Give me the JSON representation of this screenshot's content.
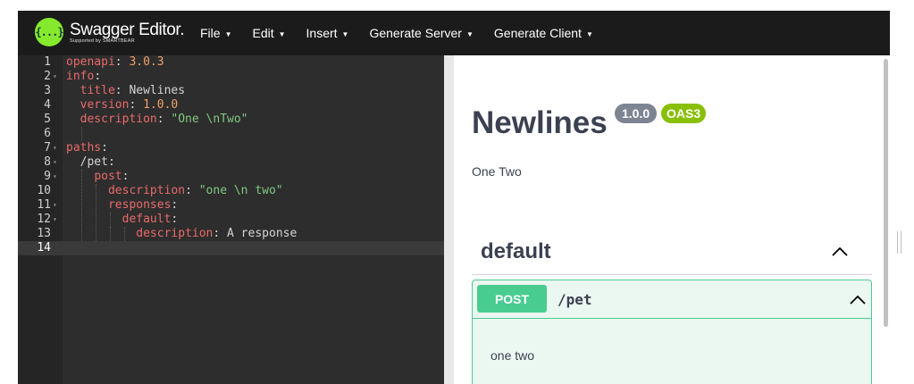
{
  "brand": {
    "title": "Swagger Editor.",
    "subtitle": "Supported by SMARTBEAR",
    "logo_glyph": "{...}"
  },
  "menu": [
    {
      "label": "File"
    },
    {
      "label": "Edit"
    },
    {
      "label": "Insert"
    },
    {
      "label": "Generate Server"
    },
    {
      "label": "Generate Client"
    }
  ],
  "editor": {
    "active_line": 14,
    "line_numbers": [
      "1",
      "2",
      "3",
      "4",
      "5",
      "6",
      "7",
      "8",
      "9",
      "10",
      "11",
      "12",
      "13",
      "14"
    ],
    "foldable_lines": [
      2,
      7,
      8,
      9,
      11,
      12
    ],
    "lines": [
      [
        {
          "c": "k",
          "t": "openapi"
        },
        {
          "c": "p",
          "t": ": "
        },
        {
          "c": "n",
          "t": "3.0.3"
        }
      ],
      [
        {
          "c": "k",
          "t": "info"
        },
        {
          "c": "p",
          "t": ":"
        }
      ],
      [
        {
          "c": "p",
          "t": "  "
        },
        {
          "c": "k",
          "t": "title"
        },
        {
          "c": "p",
          "t": ": "
        },
        {
          "c": "t",
          "t": "Newlines"
        }
      ],
      [
        {
          "c": "p",
          "t": "  "
        },
        {
          "c": "k",
          "t": "version"
        },
        {
          "c": "p",
          "t": ": "
        },
        {
          "c": "n",
          "t": "1.0.0"
        }
      ],
      [
        {
          "c": "p",
          "t": "  "
        },
        {
          "c": "k",
          "t": "description"
        },
        {
          "c": "p",
          "t": ": "
        },
        {
          "c": "s",
          "t": "\"One \\nTwo\""
        }
      ],
      [],
      [
        {
          "c": "k",
          "t": "paths"
        },
        {
          "c": "p",
          "t": ":"
        }
      ],
      [
        {
          "c": "p",
          "t": "  "
        },
        {
          "c": "t",
          "t": "/pet"
        },
        {
          "c": "p",
          "t": ":"
        }
      ],
      [
        {
          "c": "p",
          "t": "    "
        },
        {
          "c": "k",
          "t": "post"
        },
        {
          "c": "p",
          "t": ":"
        }
      ],
      [
        {
          "c": "p",
          "t": "      "
        },
        {
          "c": "k",
          "t": "description"
        },
        {
          "c": "p",
          "t": ": "
        },
        {
          "c": "s",
          "t": "\"one \\n two\""
        }
      ],
      [
        {
          "c": "p",
          "t": "      "
        },
        {
          "c": "k",
          "t": "responses"
        },
        {
          "c": "p",
          "t": ":"
        }
      ],
      [
        {
          "c": "p",
          "t": "        "
        },
        {
          "c": "k",
          "t": "default"
        },
        {
          "c": "p",
          "t": ":"
        }
      ],
      [
        {
          "c": "p",
          "t": "          "
        },
        {
          "c": "k",
          "t": "description"
        },
        {
          "c": "p",
          "t": ": "
        },
        {
          "c": "t",
          "t": "A response"
        }
      ],
      []
    ]
  },
  "preview": {
    "title": "Newlines",
    "version_badge": "1.0.0",
    "oas_badge": "OAS3",
    "description": "One Two",
    "tag": {
      "name": "default",
      "expanded": true
    },
    "operation": {
      "method": "POST",
      "path": "/pet",
      "description": "one two",
      "expanded": true
    }
  },
  "colors": {
    "topbar": "#1b1b1b",
    "logo_green": "#85ea2d",
    "editor_bg": "#2d2d2d",
    "gutter_bg": "#252525",
    "post_green": "#49cc90",
    "version_badge": "#7d8492",
    "oas_badge": "#89bf04",
    "text_dark": "#3b4151"
  },
  "icons": {
    "fold": "fold-arrow-icon",
    "tag_toggle": "chevron-up-icon",
    "op_toggle": "chevron-up-icon"
  }
}
